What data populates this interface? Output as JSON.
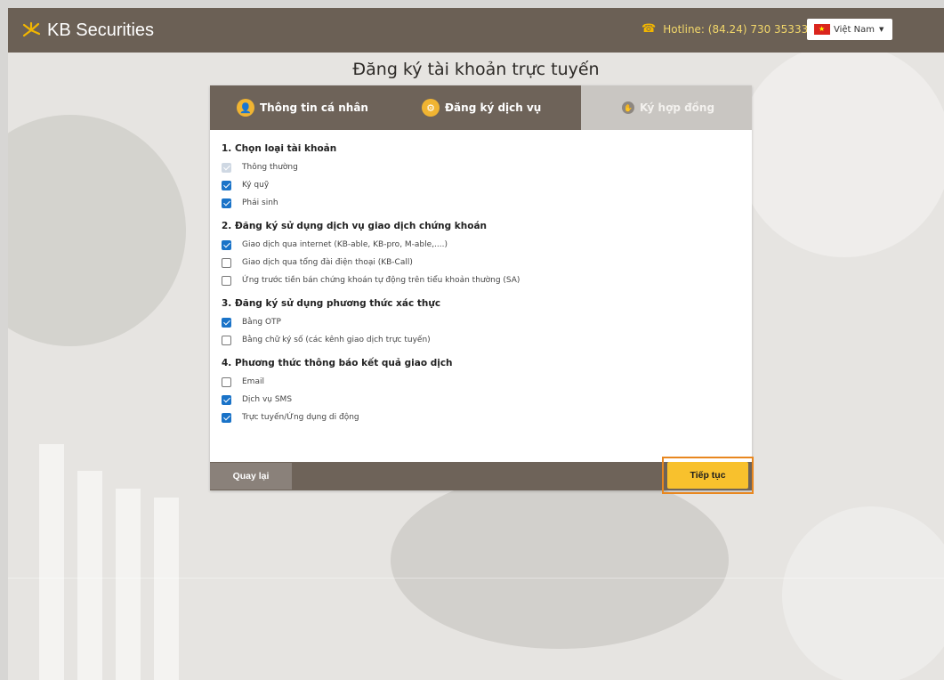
{
  "header": {
    "brand": "KB Securities",
    "hotline": "Hotline: (84.24) 730 35333",
    "language": "Việt Nam"
  },
  "page_title": "Đăng ký tài khoản trực tuyến",
  "steps": [
    {
      "label": "Thông tin cá nhân",
      "state": "done"
    },
    {
      "label": "Đăng ký dịch vụ",
      "state": "active"
    },
    {
      "label": "Ký hợp đồng",
      "state": "pending"
    }
  ],
  "sections": [
    {
      "title": "1. Chọn loại tài khoản",
      "options": [
        {
          "label": "Thông thường",
          "checked": true,
          "disabled": true
        },
        {
          "label": "Ký quỹ",
          "checked": true,
          "disabled": false
        },
        {
          "label": "Phái sinh",
          "checked": true,
          "disabled": false
        }
      ]
    },
    {
      "title": "2. Đăng ký sử dụng dịch vụ giao dịch chứng khoán",
      "options": [
        {
          "label": "Giao dịch qua internet (KB-able, KB-pro, M-able,....)",
          "checked": true,
          "disabled": false
        },
        {
          "label": "Giao dịch qua tổng đài điện thoại (KB-Call)",
          "checked": false,
          "disabled": false
        },
        {
          "label": "Ứng trước tiền bán chứng khoán tự động trên tiểu khoản thường (SA)",
          "checked": false,
          "disabled": false
        }
      ]
    },
    {
      "title": "3. Đăng ký sử dụng phương thức xác thực",
      "options": [
        {
          "label": "Bằng OTP",
          "checked": true,
          "disabled": false
        },
        {
          "label": "Bằng chữ ký số (các kênh giao dịch trực tuyến)",
          "checked": false,
          "disabled": false
        }
      ]
    },
    {
      "title": "4. Phương thức thông báo kết quả giao dịch",
      "options": [
        {
          "label": "Email",
          "checked": false,
          "disabled": false
        },
        {
          "label": "Dịch vụ SMS",
          "checked": true,
          "disabled": false
        },
        {
          "label": "Trực tuyến/Ứng dụng di động",
          "checked": true,
          "disabled": false
        }
      ]
    }
  ],
  "footer": {
    "back_label": "Quay lại",
    "next_label": "Tiếp tục"
  },
  "colors": {
    "header_bg": "#6b6055",
    "accent_yellow": "#f8c12d",
    "highlight_orange": "#e8871f",
    "checkbox_blue": "#1a73c8"
  },
  "icons": {
    "logo": "kb-star-logo-icon",
    "hotline": "phone-icon",
    "flag": "vietnam-flag-icon",
    "step1": "user-icon",
    "step2": "settings-icon",
    "step3": "handshake-icon"
  }
}
